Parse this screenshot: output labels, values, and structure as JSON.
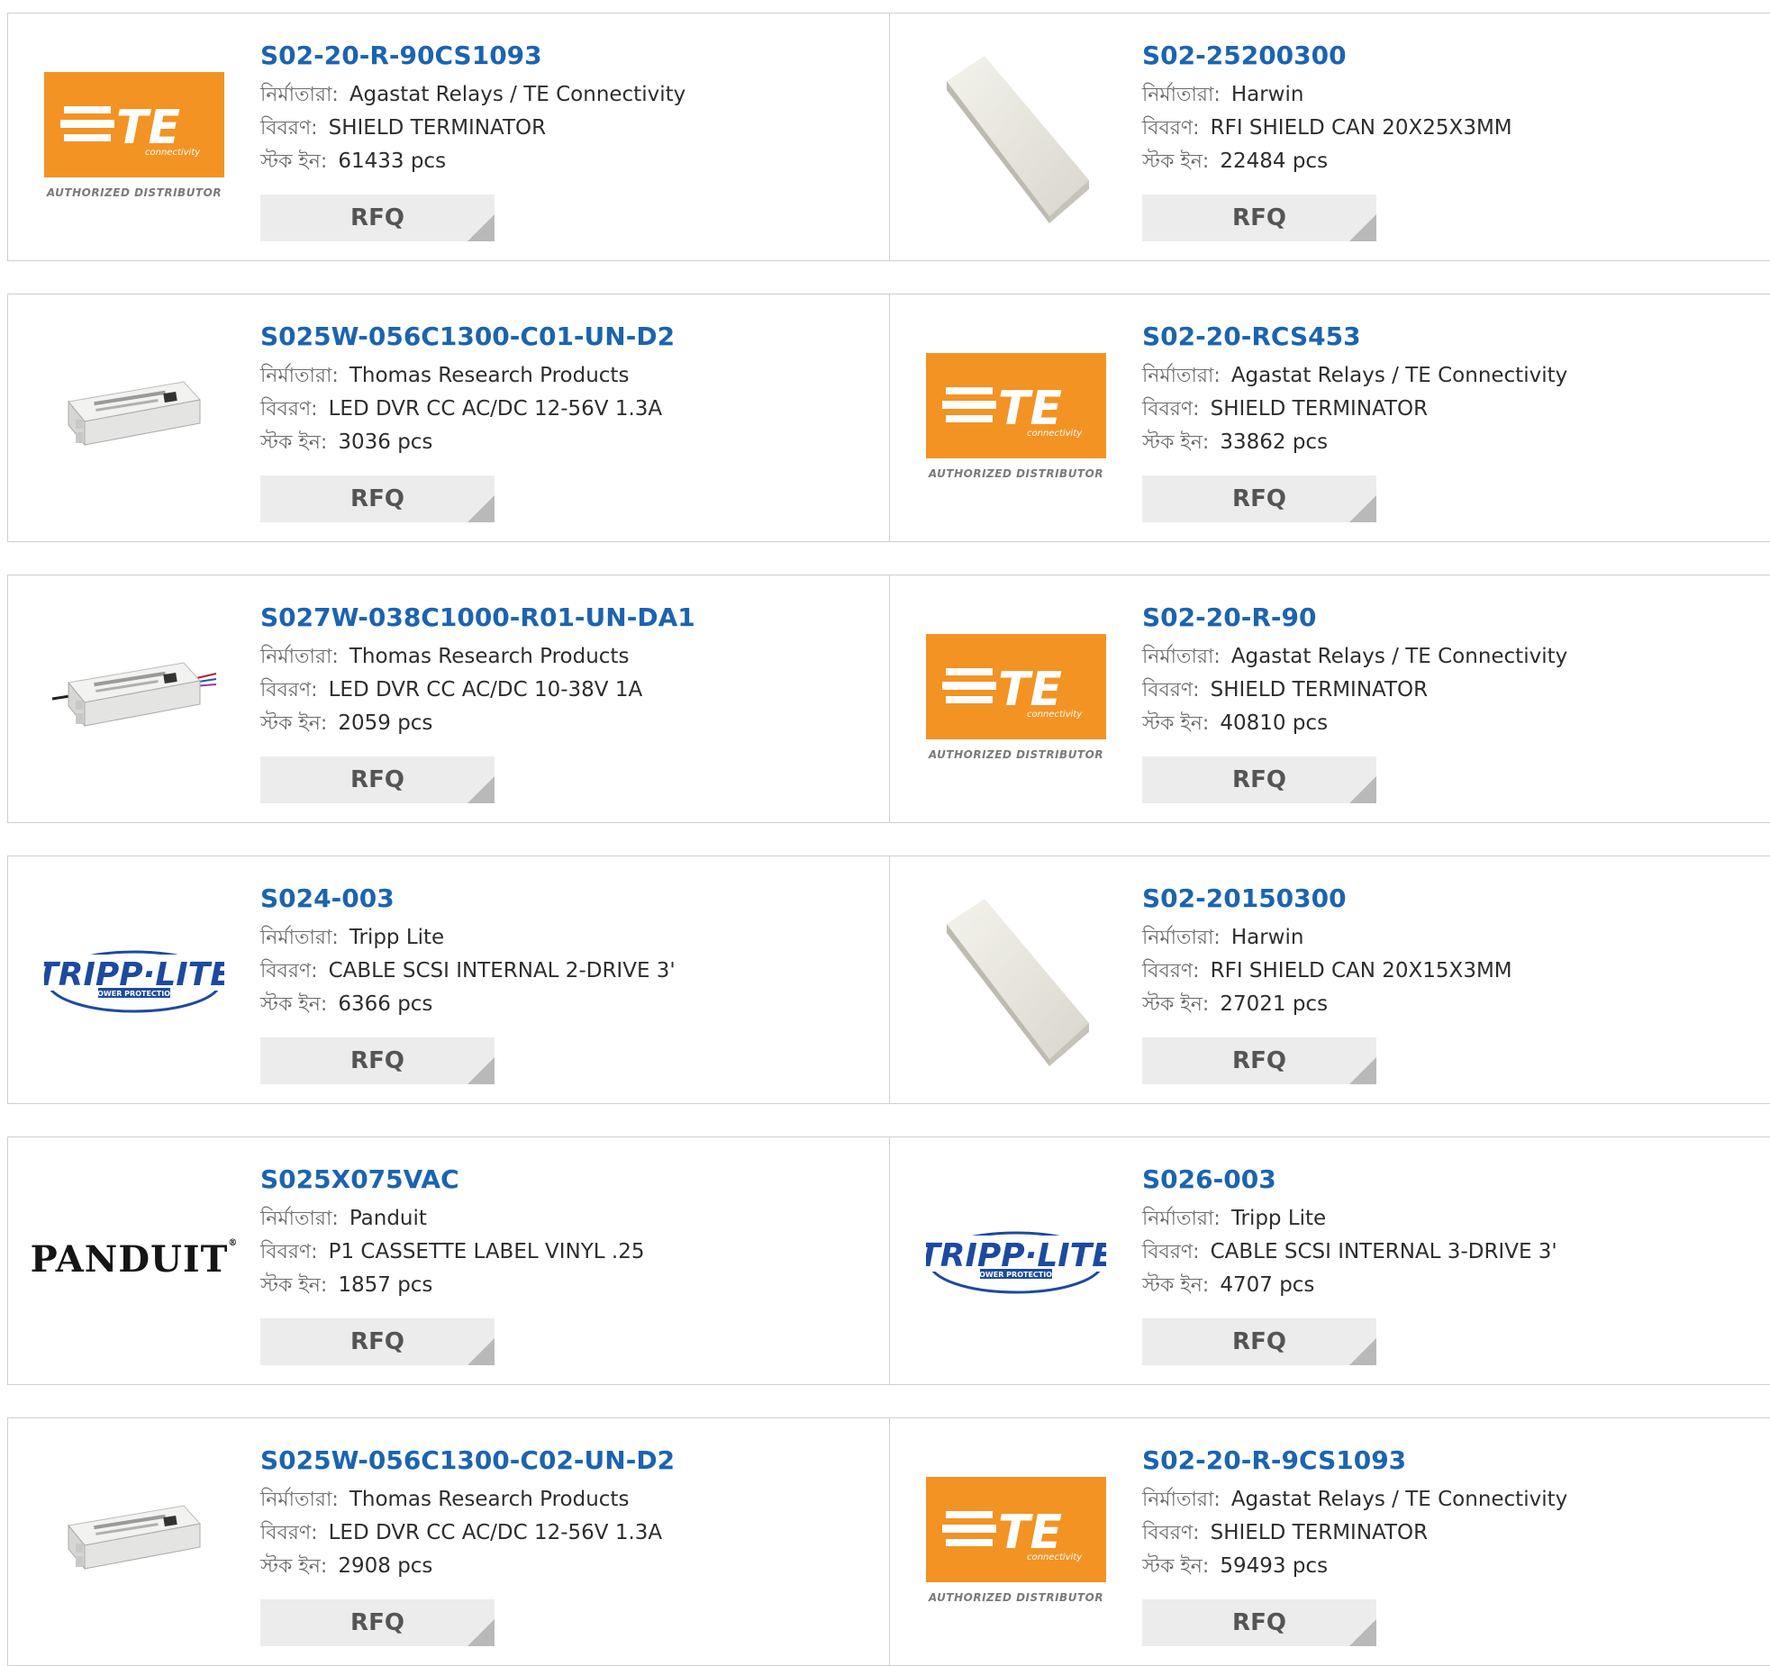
{
  "labels": {
    "manufacturer": "নির্মাতারা:",
    "description": "বিবরণ:",
    "stock": "স্টক ইন:"
  },
  "logo_text": {
    "te_brand": "TE",
    "te_sub": "connectivity",
    "te_authorized": "AUTHORIZED DISTRIBUTOR",
    "tripp": "TRIPP·LITE",
    "tripp_sub": "POWER PROTECTION",
    "panduit": "PANDUIT"
  },
  "colors": {
    "te_orange": "#f39324",
    "link_blue": "#1b64b0",
    "tripp_blue": "#1c4aa0"
  },
  "products": [
    {
      "part": "S02-20-R-90CS1093",
      "manufacturer": "Agastat Relays / TE Connectivity",
      "description": "SHIELD TERMINATOR",
      "stock": "61433 pcs",
      "logo": "te-logo",
      "button": "RFQ"
    },
    {
      "part": "S02-25200300",
      "manufacturer": "Harwin",
      "description": "RFI SHIELD CAN 20X25X3MM",
      "stock": "22484 pcs",
      "logo": "shield-can-photo",
      "button": "RFQ"
    },
    {
      "part": "S025W-056C1300-C01-UN-D2",
      "manufacturer": "Thomas Research Products",
      "description": "LED DVR CC AC/DC 12-56V 1.3A",
      "stock": "3036 pcs",
      "logo": "led-driver-photo",
      "button": "RFQ"
    },
    {
      "part": "S02-20-RCS453",
      "manufacturer": "Agastat Relays / TE Connectivity",
      "description": "SHIELD TERMINATOR",
      "stock": "33862 pcs",
      "logo": "te-logo",
      "button": "RFQ"
    },
    {
      "part": "S027W-038C1000-R01-UN-DA1",
      "manufacturer": "Thomas Research Products",
      "description": "LED DVR CC AC/DC 10-38V 1A",
      "stock": "2059 pcs",
      "logo": "led-driver-wired-photo",
      "button": "RFQ"
    },
    {
      "part": "S02-20-R-90",
      "manufacturer": "Agastat Relays / TE Connectivity",
      "description": "SHIELD TERMINATOR",
      "stock": "40810 pcs",
      "logo": "te-logo",
      "button": "RFQ"
    },
    {
      "part": "S024-003",
      "manufacturer": "Tripp Lite",
      "description": "CABLE SCSI INTERNAL 2-DRIVE 3'",
      "stock": "6366 pcs",
      "logo": "tripp-lite-logo",
      "button": "RFQ"
    },
    {
      "part": "S02-20150300",
      "manufacturer": "Harwin",
      "description": "RFI SHIELD CAN 20X15X3MM",
      "stock": "27021 pcs",
      "logo": "shield-can-photo",
      "button": "RFQ"
    },
    {
      "part": "S025X075VAC",
      "manufacturer": "Panduit",
      "description": "P1 CASSETTE LABEL VINYL .25",
      "stock": "1857 pcs",
      "logo": "panduit-logo",
      "button": "RFQ"
    },
    {
      "part": "S026-003",
      "manufacturer": "Tripp Lite",
      "description": "CABLE SCSI INTERNAL 3-DRIVE 3'",
      "stock": "4707 pcs",
      "logo": "tripp-lite-logo",
      "button": "RFQ"
    },
    {
      "part": "S025W-056C1300-C02-UN-D2",
      "manufacturer": "Thomas Research Products",
      "description": "LED DVR CC AC/DC 12-56V 1.3A",
      "stock": "2908 pcs",
      "logo": "led-driver-photo",
      "button": "RFQ"
    },
    {
      "part": "S02-20-R-9CS1093",
      "manufacturer": "Agastat Relays / TE Connectivity",
      "description": "SHIELD TERMINATOR",
      "stock": "59493 pcs",
      "logo": "te-logo",
      "button": "RFQ"
    }
  ]
}
